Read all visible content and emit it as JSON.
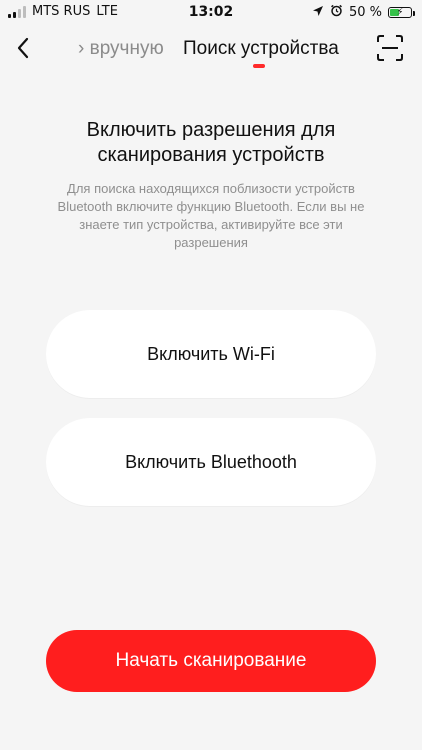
{
  "status_bar": {
    "carrier": "MTS RUS",
    "network": "LTE",
    "time": "13:02",
    "battery_text": "50 %",
    "battery_level": 0.5,
    "battery_color": "#36c24a"
  },
  "nav": {
    "tab_manual": "› вручную",
    "tab_search": "Поиск устройства",
    "indicator_color": "#ff2a2a"
  },
  "main": {
    "headline": "Включить разрешения для сканирования устройств",
    "description": "Для поиска находящихся поблизости устройств Bluetooth включите функцию Bluetooth. Если вы не знаете тип устройства, активируйте все эти разрешения",
    "wifi_button": "Включить Wi-Fi",
    "bluetooth_button": "Включить Bluethooth",
    "start_button": "Начать сканирование",
    "accent_color": "#ff1e1e"
  },
  "icons": {
    "back": "chevron-left-icon",
    "scan": "scan-frame-icon",
    "location": "location-arrow-icon",
    "alarm": "alarm-icon",
    "battery": "battery-icon",
    "charging": "bolt-icon"
  }
}
